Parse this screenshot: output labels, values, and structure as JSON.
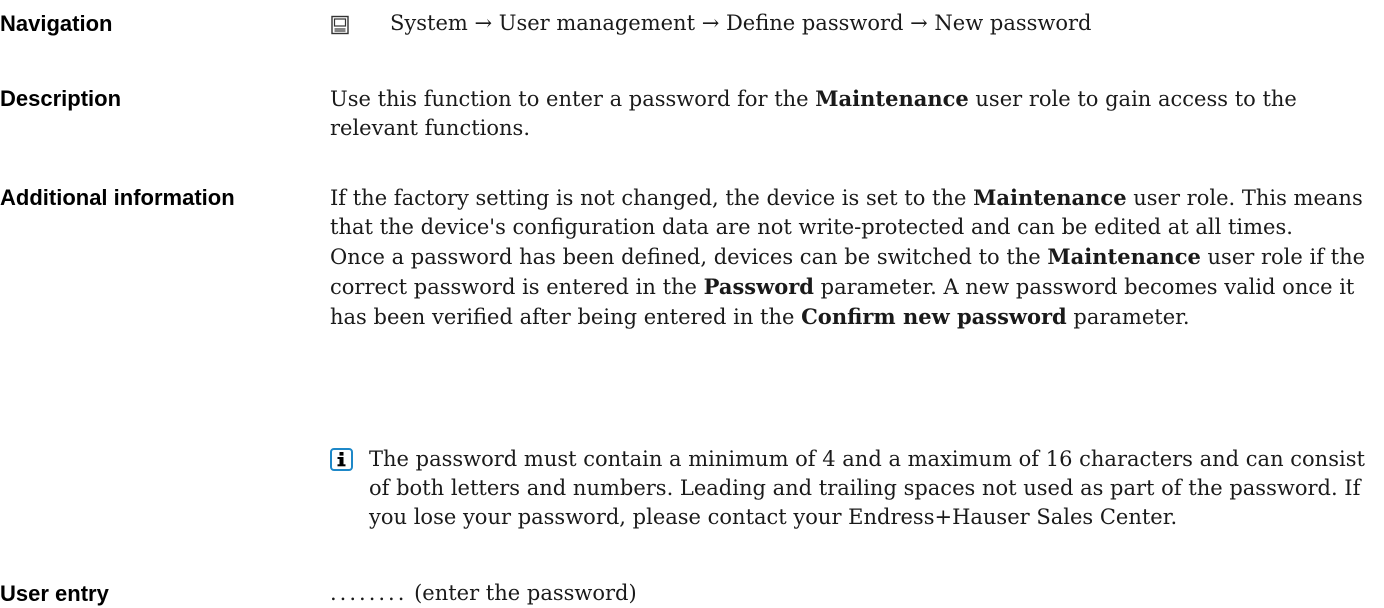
{
  "navigation": {
    "label": "Navigation",
    "path": "System → User management → Define password → New password",
    "icon": "display-operation-icon"
  },
  "description": {
    "label": "Description",
    "before": "Use this function to enter a password for the ",
    "bold1": "Maintenance",
    "after": " user role to gain access to the relevant functions."
  },
  "additional_information": {
    "label": "Additional information",
    "para1": {
      "t1": "If the factory setting is not changed, the device is set to the ",
      "b1": "Maintenance",
      "t2": " user role. This means that the device's configuration data are not write-protected and can be edited at all times."
    },
    "para2": {
      "t1": "Once a password has been defined, devices can be switched to the ",
      "b1": "Maintenance",
      "t2": " user role if the correct password is entered in the ",
      "b2": "Password",
      "t3": " parameter. A new password becomes valid once it has been verified after being entered in the ",
      "b3": "Confirm new password",
      "t4": " parameter."
    },
    "tip": {
      "icon": "info-icon",
      "text": "The password must contain a minimum of 4 and a maximum of 16 characters and can consist of both letters and numbers. Leading and trailing spaces not used as part of the password. If you lose your password, please contact your Endress+Hauser Sales Center."
    }
  },
  "user_entry": {
    "label": "User entry",
    "dots": "........",
    "text": " (enter the password)"
  },
  "colors": {
    "info_icon_border": "#1e88c8",
    "text": "#1a1a1a"
  }
}
